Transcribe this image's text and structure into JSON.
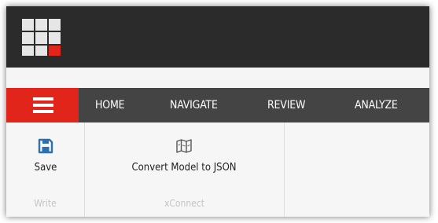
{
  "colors": {
    "topbar": "#2b2b2b",
    "navbar": "#444444",
    "accent_red": "#e1251b",
    "save_icon": "#2e6fb0",
    "ribbon_bg": "#f6f6f6"
  },
  "logo": {
    "icon": "sitecore-grid-logo"
  },
  "menu": {
    "icon": "hamburger-icon"
  },
  "nav": {
    "tabs": [
      {
        "label": "HOME"
      },
      {
        "label": "NAVIGATE"
      },
      {
        "label": "REVIEW"
      },
      {
        "label": "ANALYZE"
      }
    ]
  },
  "ribbon": {
    "groups": [
      {
        "label": "Write",
        "buttons": [
          {
            "label": "Save",
            "icon": "floppy-disk-icon"
          }
        ]
      },
      {
        "label": "xConnect",
        "buttons": [
          {
            "label": "Convert Model to JSON",
            "icon": "map-icon"
          }
        ]
      }
    ]
  }
}
